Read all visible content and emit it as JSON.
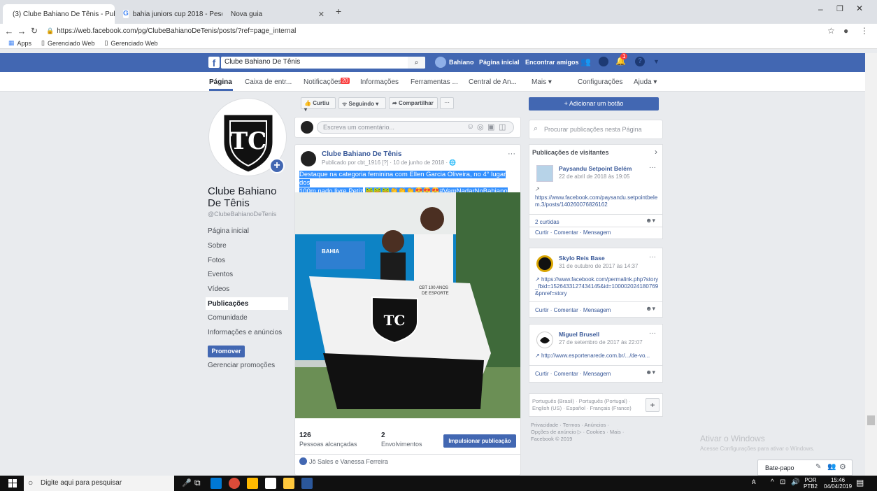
{
  "browser": {
    "tabs": [
      {
        "title": "(3) Clube Bahiano De Tênis - Pub"
      },
      {
        "title": "bahia juniors cup 2018 - Pesquis"
      },
      {
        "title": "Nova guia"
      }
    ],
    "url": "https://web.facebook.com/pg/ClubeBahianoDeTenis/posts/?ref=page_internal",
    "bookmarks": [
      "Apps",
      "Gerenciado Web",
      "Gerenciado Web"
    ]
  },
  "fb": {
    "search_value": "Clube Bahiano De Tênis",
    "user": "Bahiano",
    "home": "Página inicial",
    "find_friends": "Encontrar amigos",
    "notif_count": "1"
  },
  "page_tabs": [
    {
      "label": "Página"
    },
    {
      "label": "Caixa de entr..."
    },
    {
      "label": "Notificações"
    },
    {
      "label": "Informações"
    },
    {
      "label": "Ferramentas ..."
    },
    {
      "label": "Central de An..."
    },
    {
      "label": "Mais ▾"
    },
    {
      "label": "Configurações"
    },
    {
      "label": "Ajuda ▾"
    }
  ],
  "notif_badge": "20",
  "profile": {
    "name": "Clube Bahiano De Tênis",
    "handle": "@ClubeBahianoDeTenis"
  },
  "left_nav": [
    "Página inicial",
    "Sobre",
    "Fotos",
    "Eventos",
    "Vídeos",
    "Publicações",
    "Comunidade",
    "Informações e anúncios"
  ],
  "promote": {
    "button": "Promover",
    "manage": "Gerenciar promoções"
  },
  "action_bar": {
    "liked": "Curtiu ▾",
    "following": "Seguindo ▾",
    "share": "Compartilhar",
    "more": "···"
  },
  "comment_placeholder": "Escreva um comentário...",
  "post": {
    "author": "Clube Bahiano De Tênis",
    "meta": "Publicado por cbt_1916 [?] · 10 de junho de 2018 ·",
    "text_line1": "Destaque na categoria feminina com Ellen Garcia Oliveira, no 4° lugar dos",
    "text_line2": "100m nado livre Petiz",
    "hashtag": "#VemNadarNoBahiano",
    "reach_count": "126",
    "reach_label": "Pessoas alcançadas",
    "engagement_count": "2",
    "engagement_label": "Envolvimentos",
    "boost": "Impulsionar publicação",
    "likers": "Jô Sales e Vanessa Ferreira",
    "photo_banner": "BAHIA",
    "shirt_text1": "CBT 100 ANOS",
    "shirt_text2": "DE ESPORTE"
  },
  "right": {
    "add_button": "+ Adicionar um botão",
    "search_placeholder": "Procurar publicações nesta Página",
    "visitors_title": "Publicações de visitantes",
    "visitor_posts": [
      {
        "name": "Paysandu Setpoint Belém",
        "date": "22 de abril de 2018 às 19:05",
        "link": "https://www.facebook.com/paysandu.setpointbelem.3/posts/140260076826162",
        "likes": "2 curtidas",
        "actions": "Curtir · Comentar · Mensagem"
      },
      {
        "name": "Skylo Reis Base",
        "date": "31 de outubro de 2017 às 14:37",
        "link": "https://www.facebook.com/permalink.php?story_fbid=1526433127434145&id=100002024180769&pnref=story",
        "actions": "Curtir · Comentar · Mensagem"
      },
      {
        "name": "Miguel Brusell",
        "date": "27 de setembro de 2017 às 22:07",
        "link": "http://www.esportenarede.com.br/.../de-vo...",
        "actions": "Curtir · Comentar · Mensagem"
      }
    ],
    "languages_line1": "Português (Brasil) · Português (Portugal) ·",
    "languages_line2": "English (US) · Español · Français (France)",
    "footer_line1": "Privacidade · Termos · Anúncios ·",
    "footer_line2": "Opções de anúncio ▷ · Cookies · Mais ·",
    "footer_line3": "Facebook © 2019"
  },
  "watermark": {
    "title": "Ativar o Windows",
    "sub": "Acesse Configurações para ativar o Windows."
  },
  "chat": {
    "label": "Bate-papo"
  },
  "taskbar": {
    "search": "Digite aqui para pesquisar",
    "lang1": "POR",
    "lang2": "PTB2",
    "time": "15:46",
    "date": "04/04/2019"
  }
}
